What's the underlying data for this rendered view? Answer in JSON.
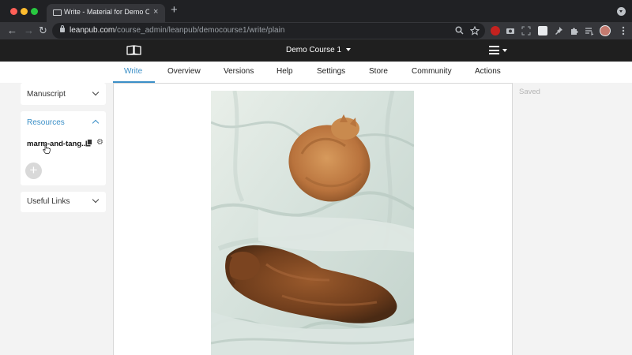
{
  "browser": {
    "tab_title": "Write - Material for Demo Course 1",
    "tab_close": "×",
    "new_tab": "+",
    "nav": {
      "back": "←",
      "forward": "→",
      "reload": "↻"
    },
    "url_host": "leanpub.com",
    "url_path": "/course_admin/leanpub/democourse1/write/plain"
  },
  "app": {
    "course_name": "Demo Course 1",
    "nav_tabs": [
      {
        "label": "Write",
        "active": true
      },
      {
        "label": "Overview"
      },
      {
        "label": "Versions"
      },
      {
        "label": "Help"
      },
      {
        "label": "Settings"
      },
      {
        "label": "Store"
      },
      {
        "label": "Community"
      },
      {
        "label": "Actions"
      }
    ],
    "accent_color": "#3b8fc7"
  },
  "sidebar": {
    "manuscript": {
      "label": "Manuscript"
    },
    "resources": {
      "label": "Resources",
      "item": "marm-and-tang...",
      "add": "+"
    },
    "useful_links": {
      "label": "Useful Links"
    }
  },
  "editor": {
    "status": "Saved"
  }
}
